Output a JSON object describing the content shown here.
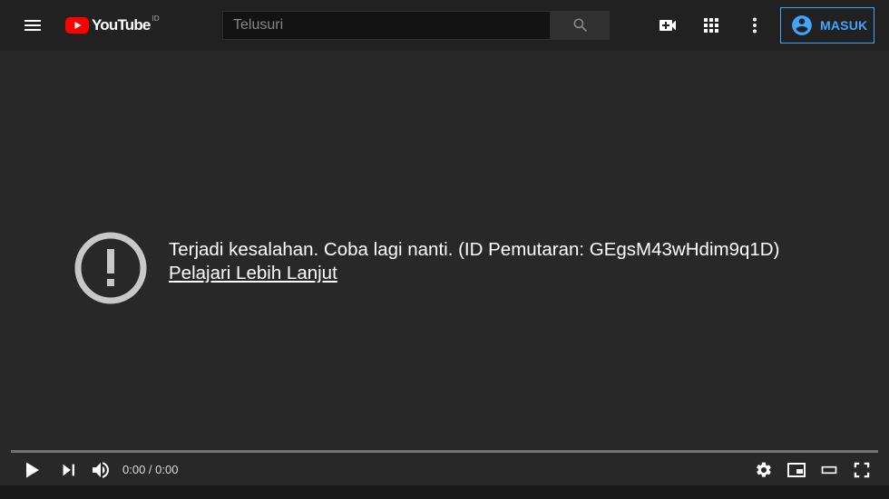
{
  "header": {
    "logo_text": "YouTube",
    "logo_country": "ID",
    "search_placeholder": "Telusuri",
    "signin_label": "MASUK"
  },
  "icons": {
    "menu": "hamburger-menu-icon",
    "search": "search-icon",
    "create": "video-camera-add-icon",
    "apps": "apps-grid-icon",
    "more": "more-vert-icon",
    "account": "account-circle-icon"
  },
  "player": {
    "error_message": "Terjadi kesalahan. Coba lagi nanti. (ID Pemutaran: GEgsM43wHdim9q1D)",
    "learn_more": "Pelajari Lebih Lanjut",
    "time": "0:00 / 0:00"
  },
  "colors": {
    "background": "#212121",
    "player_bg": "#282828",
    "accent_blue": "#3ea6ff",
    "youtube_red": "#ff0000"
  }
}
